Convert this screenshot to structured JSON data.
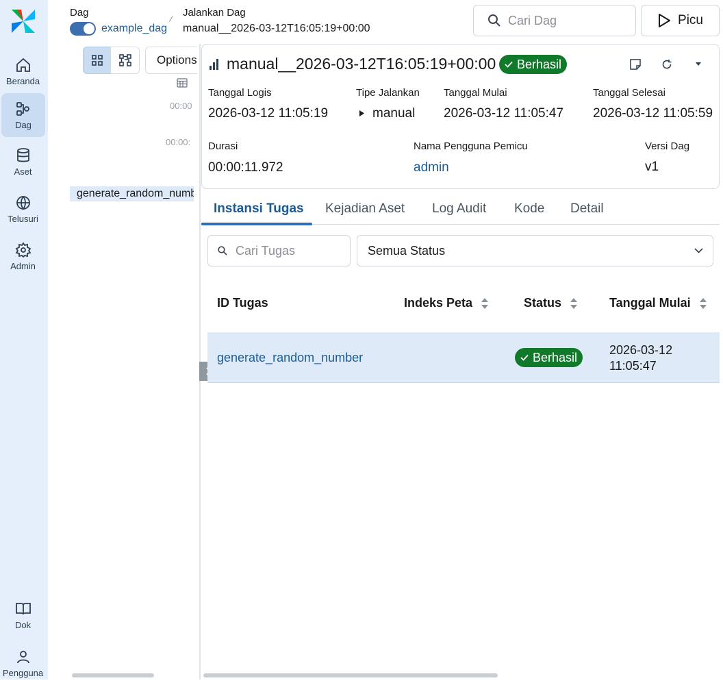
{
  "nav": {
    "items": [
      {
        "label": "Beranda",
        "icon": "home-icon"
      },
      {
        "label": "Dag",
        "icon": "dag-icon",
        "active": true
      },
      {
        "label": "Aset",
        "icon": "database-icon"
      },
      {
        "label": "Telusuri",
        "icon": "globe-icon"
      },
      {
        "label": "Admin",
        "icon": "gear-icon"
      }
    ],
    "bottom": [
      {
        "label": "Dok",
        "icon": "book-icon"
      },
      {
        "label": "Pengguna",
        "icon": "user-icon"
      }
    ]
  },
  "breadcrumb": {
    "dag_label": "Dag",
    "dag_name": "example_dag",
    "run_label": "Jalankan Dag",
    "run_id": "manual__2026-03-12T16:05:19+00:00"
  },
  "search": {
    "placeholder": "Cari Dag"
  },
  "trigger": {
    "label": "Picu"
  },
  "grid_panel": {
    "options_label": "Options",
    "times": [
      "00:00",
      "00:00:"
    ],
    "task": "generate_random_numb"
  },
  "run": {
    "title": "manual__2026-03-12T16:05:19+00:00",
    "state": "Berhasil",
    "state_color": "#117a2a",
    "fields": {
      "logical_date": {
        "label": "Tanggal Logis",
        "value": "2026-03-12 11:05:19"
      },
      "run_type": {
        "label": "Tipe Jalankan",
        "value": "manual"
      },
      "start_date": {
        "label": "Tanggal Mulai",
        "value": "2026-03-12 11:05:47"
      },
      "end_date": {
        "label": "Tanggal Selesai",
        "value": "2026-03-12 11:05:59"
      },
      "duration": {
        "label": "Durasi",
        "value": "00:00:11.972"
      },
      "triggered_by": {
        "label": "Nama Pengguna Pemicu",
        "value": "admin"
      },
      "dag_version": {
        "label": "Versi Dag",
        "value": "v1"
      }
    }
  },
  "tabs": [
    "Instansi Tugas",
    "Kejadian Aset",
    "Log Audit",
    "Kode",
    "Detail"
  ],
  "filters": {
    "task_search_placeholder": "Cari Tugas",
    "status_selected": "Semua Status"
  },
  "table": {
    "headers": [
      "ID Tugas",
      "Indeks Peta",
      "Status",
      "Tanggal Mulai"
    ],
    "rows": [
      {
        "task_id": "generate_random_number",
        "map_index": "",
        "status": "Berhasil",
        "start_date_line1": "2026-03-12",
        "start_date_line2": "11:05:47"
      }
    ]
  },
  "colors": {
    "accent": "#2f6db5",
    "link": "#1c5b93",
    "success": "#117a2a",
    "nav_bg": "#e4effb"
  }
}
